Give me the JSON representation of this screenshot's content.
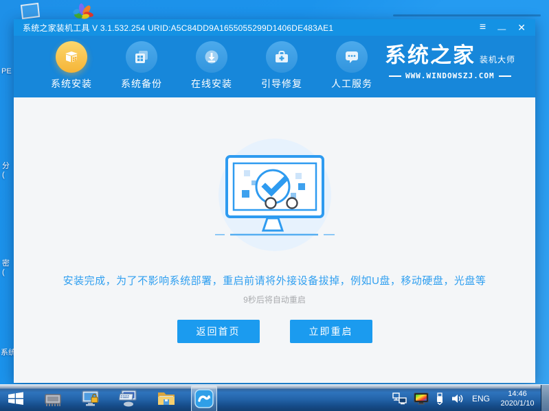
{
  "colors": {
    "desktop_blue": "#1e95ec",
    "titlebar_blue": "#1492e4",
    "navbar_blue": "#1787da",
    "accent_blue": "#1b9bef",
    "active_orange": "#f5b437",
    "content_bg": "#f4f6f8",
    "message_blue": "#2f9ff0",
    "countdown_gray": "#a9abae"
  },
  "desktop": {
    "partial_icon_labels": [
      "PE",
      "分\n(",
      "密\n(",
      "系统"
    ]
  },
  "window": {
    "title": "系统之家装机工具 V 3.1.532.254 URID:A5C84DD9A1655055299D1406DE483AE1",
    "controls": {
      "menu": "≡",
      "minimize": "—",
      "close": "✕"
    },
    "nav": {
      "items": [
        {
          "label": "系统安装",
          "icon": "install-box-icon",
          "active": true
        },
        {
          "label": "系统备份",
          "icon": "backup-copy-icon",
          "active": false
        },
        {
          "label": "在线安装",
          "icon": "download-circle-icon",
          "active": false
        },
        {
          "label": "引导修复",
          "icon": "repair-toolbox-icon",
          "active": false
        },
        {
          "label": "人工服务",
          "icon": "chat-bubble-icon",
          "active": false
        }
      ],
      "logo": {
        "brand": "系统之家",
        "tagline": "装机大师",
        "website": "WWW.WINDOWSZJ.COM"
      }
    },
    "main": {
      "message": "安装完成，为了不影响系统部署，重启前请将外接设备拔掉，例如U盘，移动硬盘，光盘等",
      "countdown": "9秒后将自动重启",
      "back_button": "返回首页",
      "restart_button": "立即重启"
    }
  },
  "taskbar": {
    "tray": {
      "language": "ENG",
      "time": "14:46",
      "date": "2020/1/10"
    }
  }
}
